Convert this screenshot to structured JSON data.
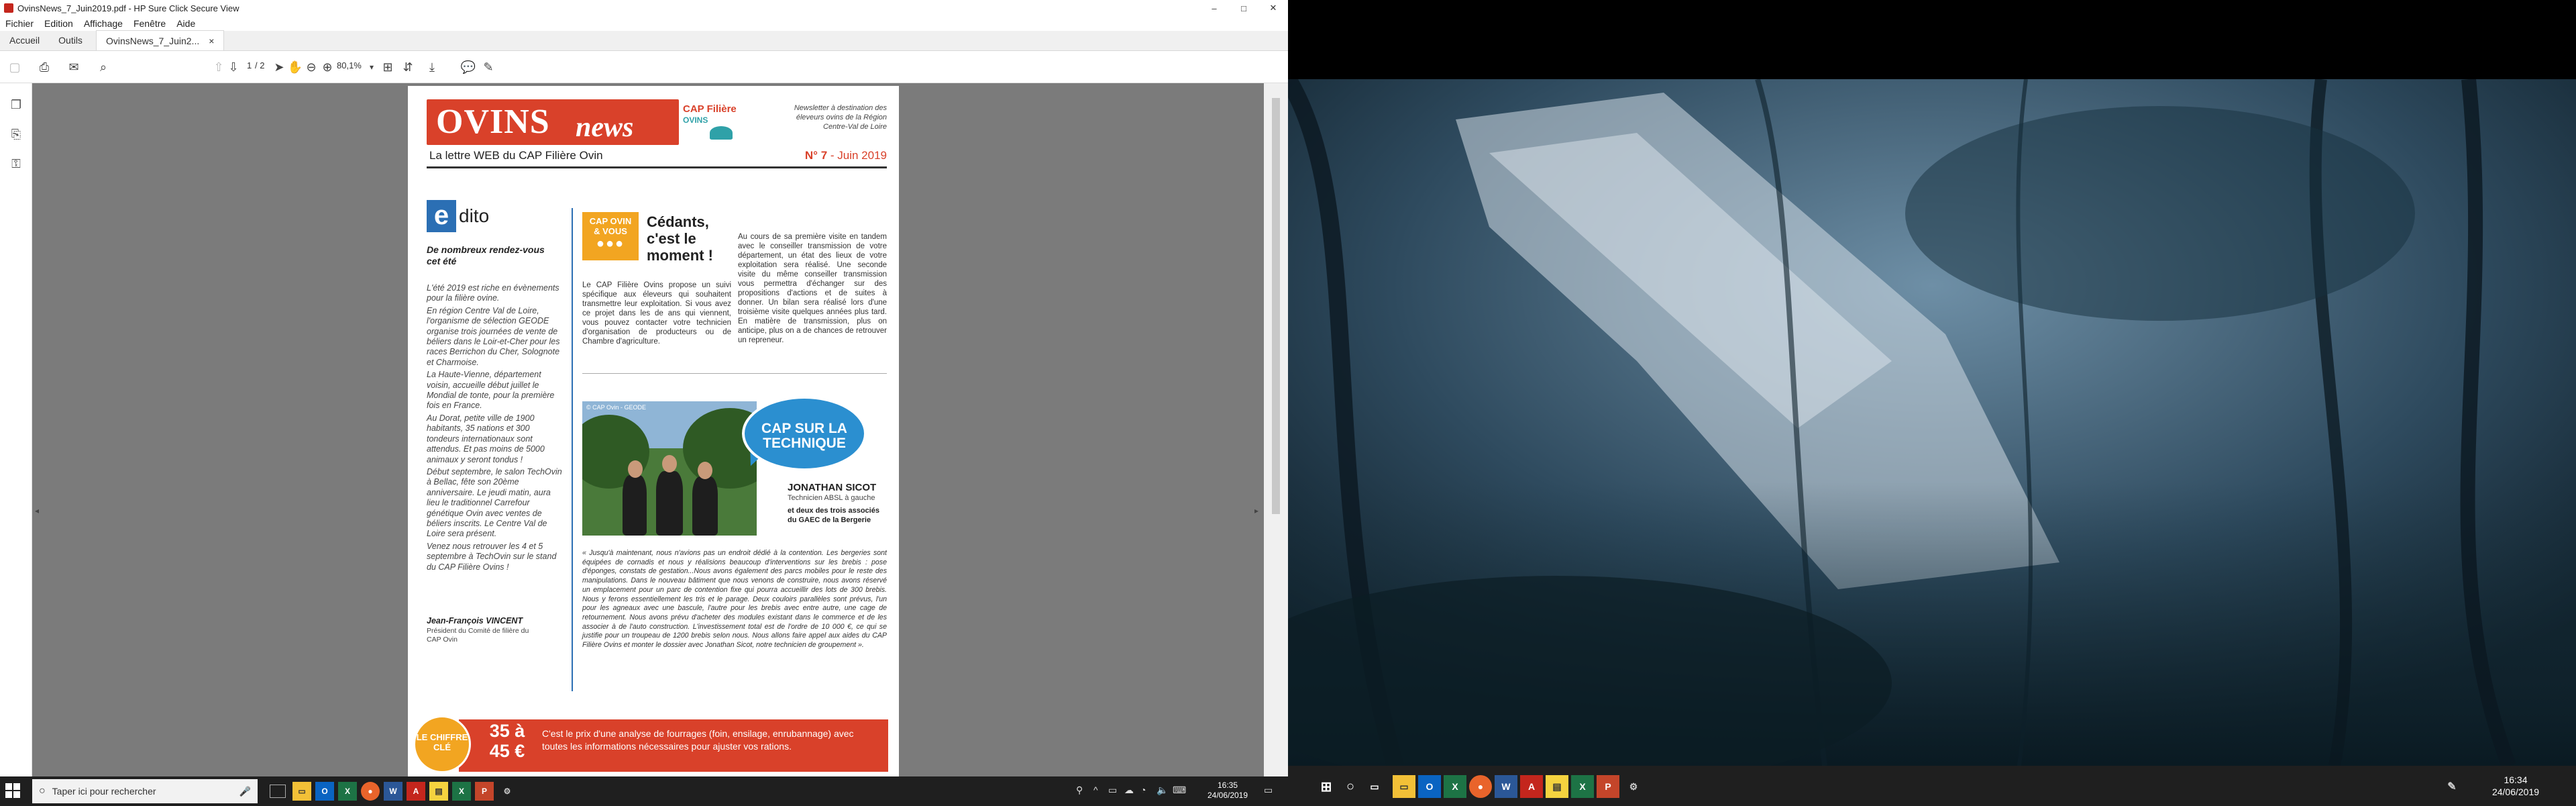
{
  "window": {
    "title": "OvinsNews_7_Juin2019.pdf - HP Sure Click Secure View",
    "minimize": "–",
    "maximize": "□",
    "close": "✕"
  },
  "menu": [
    "Fichier",
    "Edition",
    "Affichage",
    "Fenêtre",
    "Aide"
  ],
  "tabs": {
    "home": "Accueil",
    "tools": "Outils",
    "document": "OvinsNews_7_Juin2...",
    "document_close": "×"
  },
  "toolbar": {
    "page_current": "1",
    "page_total": "/ 2",
    "zoom": "80,1%"
  },
  "newsletter": {
    "logo_main": "OVINS",
    "logo_news": "news",
    "cap_logo_line1": "CAP Filière",
    "cap_logo_line2": "OVINS",
    "description": "Newsletter à destination des éleveurs ovins de la Région Centre-Val de Loire",
    "subtitle": "La lettre WEB  du CAP Filière Ovin",
    "issue_number": "N° 7",
    "issue_date": " - Juin 2019",
    "edito": {
      "letter": "e",
      "word": "dito",
      "subtitle": "De nombreux rendez-vous cet été",
      "paragraphs": [
        "L'été 2019 est riche en évènements pour la filière ovine.",
        "En région Centre Val de Loire, l'organisme de sélection GEODE organise trois journées de vente de béliers dans le Loir-et-Cher pour les races Berrichon du Cher, Solognote et Charmoise.",
        "La Haute-Vienne, département voisin, accueille début juillet le Mondial de tonte, pour la première fois en France.",
        "Au Dorat, petite ville de 1900 habitants, 35 nations et 300 tondeurs internationaux sont attendus. Et pas moins de 5000 animaux y seront tondus !",
        "Début septembre, le salon TechOvin à Bellac, fête son 20ème anniversaire.  Le jeudi matin, aura lieu le traditionnel Carrefour génétique Ovin avec ventes de béliers inscrits. Le Centre Val de Loire sera présent.",
        "Venez nous retrouver les 4 et 5 septembre à TechOvin sur le stand du CAP Filière Ovins !"
      ],
      "signature_name": "Jean-François VINCENT",
      "signature_role": "Président du Comité de filière du CAP Ovin"
    },
    "cedants": {
      "badge_line1": "CAP OVIN",
      "badge_line2": "& VOUS",
      "title": "Cédants, c'est le moment !",
      "col_a": "Le CAP Filière Ovins propose un suivi spécifique aux éleveurs qui souhaitent transmettre leur exploitation. Si vous avez ce projet dans les de ans qui viennent, vous pouvez contacter votre technicien d'organisation de producteurs ou de Chambre d'agriculture.",
      "col_b": "Au cours de sa première visite en tandem avec le conseiller transmission de votre département, un état des lieux de votre exploitation sera réalisé. Une seconde visite du même conseiller transmission vous permettra d'échanger sur des propositions d'actions et de suites à donner. Un bilan sera réalisé lors d'une troisième visite quelques années plus tard. En matière de transmission, plus on anticipe, plus on a de chances de retrouver un repreneur."
    },
    "technique": {
      "photo_caption": "© CAP Ovin - GEODE",
      "bubble": "CAP SUR LA TECHNIQUE",
      "name": "JONATHAN SICOT",
      "role": "Technicien ABSL à gauche",
      "gaec": "et deux des trois associés du GAEC de la Bergerie",
      "quote": "« Jusqu'à maintenant, nous n'avions pas un endroit dédié à la contention. Les bergeries sont équipées de cornadis et nous y réalisions beaucoup d'interventions sur les brebis : pose d'éponges, constats de gestation...Nous avons également des parcs mobiles pour le reste des manipulations. Dans le nouveau bâtiment que nous venons de construire, nous avons réservé un emplacement pour un parc de contention fixe qui pourra accueillir des lots de 300 brebis. Nous y ferons essentiellement les tris et le parage. Deux couloirs parallèles sont prévus, l'un pour les agneaux avec une bascule, l'autre pour les brebis avec entre autre, une cage de retournement. Nous avons prévu d'acheter des modules existant dans le commerce et de les associer à de l'auto construction. L'investissement total est de l'ordre de 10 000 €, ce qui se justifie pour un troupeau de 1200 brebis selon nous. Nous allons faire appel aux aides du CAP Filière Ovins et monter le dossier avec Jonathan Sicot, notre technicien de groupement »."
    },
    "chiffre": {
      "label": "LE CHIFFRE CLÉ",
      "value": "35 à 45 €",
      "text": "C'est le prix d'une analyse de fourrages (foin, ensilage, enrubannage) avec toutes les informations nécessaires pour ajuster vos rations."
    }
  },
  "taskbar_left": {
    "search_placeholder": "Taper ici pour rechercher",
    "time": "16:35",
    "date": "24/06/2019"
  },
  "taskbar_right": {
    "time": "16:34",
    "date": "24/06/2019"
  },
  "colors": {
    "ovins_red": "#d9412a",
    "edito_blue": "#2b6fb4",
    "cap_orange": "#f2a521",
    "bubble_blue": "#2b8fd0",
    "viewport_gray": "#7b7b7b",
    "taskbar": "#1f1f1f"
  }
}
